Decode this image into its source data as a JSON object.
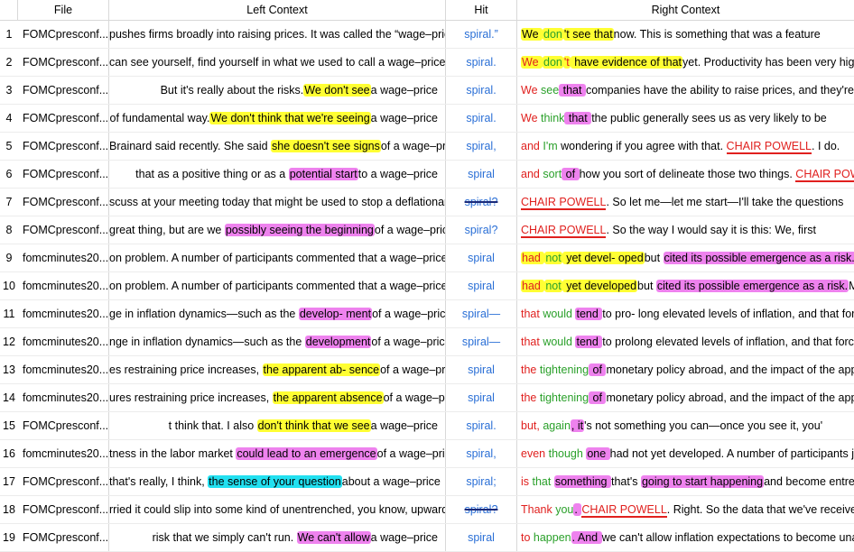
{
  "headers": {
    "file": "File",
    "left": "Left Context",
    "hit": "Hit",
    "right": "Right Context"
  },
  "rows": [
    {
      "n": "1",
      "file": "FOMCpresconf...",
      "left": [
        [
          "",
          "pushes firms broadly into raising prices. It was called the “wage–price"
        ]
      ],
      "hit": "spiral.”",
      "hit_strike": false,
      "right": [
        [
          "y",
          "We "
        ],
        [
          "yg",
          "don"
        ],
        [
          "y",
          "'t see that"
        ],
        [
          "",
          "now. This is something that was a feature"
        ]
      ]
    },
    {
      "n": "2",
      "file": "FOMCpresconf...",
      "left": [
        [
          "",
          "can see yourself, find yourself in what we used to call a wage–price"
        ]
      ],
      "hit": "spiral.",
      "hit_strike": false,
      "right": [
        [
          "yr",
          "We "
        ],
        [
          "yg",
          "don"
        ],
        [
          "yr",
          "'t"
        ],
        [
          "y",
          " have evidence of that"
        ],
        [
          "",
          "yet. Productivity has been very high."
        ]
      ]
    },
    {
      "n": "3",
      "file": "FOMCpresconf...",
      "left": [
        [
          "",
          "But it's really about the risks."
        ],
        [
          "y",
          "We don't see"
        ],
        [
          "",
          "a wage–price"
        ]
      ],
      "hit": "spiral.",
      "hit_strike": false,
      "right": [
        [
          "r",
          "We "
        ],
        [
          "g",
          "see"
        ],
        [
          "m",
          " that "
        ],
        [
          "",
          "companies have the ability to raise prices, and they're"
        ]
      ]
    },
    {
      "n": "4",
      "file": "FOMCpresconf...",
      "left": [
        [
          "",
          "of fundamental way."
        ],
        [
          "y",
          "We don't think that we're seeing"
        ],
        [
          "",
          "a wage–price"
        ]
      ],
      "hit": "spiral.",
      "hit_strike": false,
      "right": [
        [
          "r",
          "We "
        ],
        [
          "g",
          "think"
        ],
        [
          "m",
          " that "
        ],
        [
          "",
          "the public generally sees us as very likely to be"
        ]
      ]
    },
    {
      "n": "5",
      "file": "FOMCpresconf...",
      "left": [
        [
          "",
          "Brainard said recently. She said "
        ],
        [
          "y",
          "she doesn't see signs"
        ],
        [
          "",
          "of a wage–price"
        ]
      ],
      "hit": "spiral,",
      "hit_strike": false,
      "right": [
        [
          "r",
          "and "
        ],
        [
          "g",
          "I'm"
        ],
        [
          "",
          "  wondering if you agree with that. "
        ],
        [
          "u",
          "CHAIR POWELL"
        ],
        [
          "",
          ". I do."
        ]
      ]
    },
    {
      "n": "6",
      "file": "FOMCpresconf...",
      "left": [
        [
          "",
          "that as a positive thing or as a "
        ],
        [
          "m",
          "potential start"
        ],
        [
          "",
          "to a wage–price"
        ]
      ],
      "hit": "spiral",
      "hit_strike": false,
      "right": [
        [
          "r",
          "and "
        ],
        [
          "g",
          "sort"
        ],
        [
          "m",
          " of "
        ],
        [
          "",
          "how you sort of delineate those two things. "
        ],
        [
          "u",
          "CHAIR POWEL"
        ]
      ]
    },
    {
      "n": "7",
      "file": "FOMCpresconf...",
      "left": [
        [
          "",
          "scuss at your meeting today that might be used to stop a deflationary"
        ]
      ],
      "hit": "spiral?",
      "hit_strike": true,
      "right": [
        [
          "u",
          "CHAIR POWELL"
        ],
        [
          "",
          ". So let me—let me start—I'll take the questions"
        ]
      ]
    },
    {
      "n": "8",
      "file": "FOMCpresconf...",
      "left": [
        [
          "",
          "great thing, but are we "
        ],
        [
          "m",
          "possibly seeing the beginning"
        ],
        [
          "",
          "of a wage–price"
        ]
      ],
      "hit": "spiral?",
      "hit_strike": false,
      "right": [
        [
          "u",
          "CHAIR POWELL"
        ],
        [
          "",
          ". So the way I would say it is this: We, first"
        ]
      ]
    },
    {
      "n": "9",
      "file": "fomcminutes20...",
      "left": [
        [
          "",
          "on problem. A number of participants commented that a wage–price"
        ]
      ],
      "hit": "spiral",
      "hit_strike": false,
      "right": [
        [
          "yr",
          "had "
        ],
        [
          "yg",
          "not"
        ],
        [
          "y",
          " yet devel- oped"
        ],
        [
          "",
          "but "
        ],
        [
          "m",
          "cited its possible emergence as a risk."
        ]
      ]
    },
    {
      "n": "10",
      "file": "fomcminutes20...",
      "left": [
        [
          "",
          "on problem. A number of participants commented that a wage–price"
        ]
      ],
      "hit": "spiral",
      "hit_strike": false,
      "right": [
        [
          "yr",
          "had "
        ],
        [
          "yg",
          "not"
        ],
        [
          "y",
          " yet developed"
        ],
        [
          "",
          "but "
        ],
        [
          "m",
          "cited its possible emergence as a risk."
        ],
        [
          "",
          "Minu"
        ]
      ]
    },
    {
      "n": "11",
      "file": "fomcminutes20...",
      "left": [
        [
          "",
          "ge in inflation dynamics—such as the "
        ],
        [
          "m",
          "develop- ment"
        ],
        [
          "",
          "of a wage–price"
        ]
      ],
      "hit": "spiral—",
      "hit_strike": false,
      "right": [
        [
          "r",
          "that "
        ],
        [
          "g",
          "would "
        ],
        [
          "m",
          "tend "
        ],
        [
          "",
          "to pro- long elevated levels of inflation, and that forc"
        ]
      ]
    },
    {
      "n": "12",
      "file": "fomcminutes20...",
      "left": [
        [
          "",
          "nge in inflation dynamics—such as the "
        ],
        [
          "m",
          "development"
        ],
        [
          "",
          "of a wage–price"
        ]
      ],
      "hit": "spiral—",
      "hit_strike": false,
      "right": [
        [
          "r",
          "that "
        ],
        [
          "g",
          "would "
        ],
        [
          "m",
          "tend "
        ],
        [
          "",
          "to prolong elevated levels of inflation, and that forces"
        ]
      ]
    },
    {
      "n": "13",
      "file": "fomcminutes20...",
      "left": [
        [
          "",
          "es restraining price increases, "
        ],
        [
          "y",
          "the apparent ab- sence"
        ],
        [
          "",
          "of a wage–price"
        ]
      ],
      "hit": "spiral",
      "hit_strike": false,
      "right": [
        [
          "r",
          "the "
        ],
        [
          "g",
          "tightening"
        ],
        [
          "m",
          " of "
        ],
        [
          "",
          "monetary policy abroad, and the impact of the appr"
        ]
      ]
    },
    {
      "n": "14",
      "file": "fomcminutes20...",
      "left": [
        [
          "",
          "ures restraining price increases, "
        ],
        [
          "y",
          "the apparent absence"
        ],
        [
          "",
          "of a wage–price"
        ]
      ],
      "hit": "spiral",
      "hit_strike": false,
      "right": [
        [
          "r",
          "the "
        ],
        [
          "g",
          "tightening"
        ],
        [
          "m",
          " of "
        ],
        [
          "",
          "monetary policy abroad, and the impact of the appr"
        ]
      ]
    },
    {
      "n": "15",
      "file": "FOMCpresconf...",
      "left": [
        [
          "",
          "t think that. I also "
        ],
        [
          "y",
          "don't think that we see"
        ],
        [
          "",
          "a wage–price"
        ]
      ],
      "hit": "spiral.",
      "hit_strike": false,
      "right": [
        [
          "r",
          "but, "
        ],
        [
          "g",
          "again"
        ],
        [
          "m",
          ", it"
        ],
        [
          "",
          "'s not something you can—once you see it, you'"
        ]
      ]
    },
    {
      "n": "16",
      "file": "fomcminutes20...",
      "left": [
        [
          "",
          "tness in the labor market "
        ],
        [
          "m",
          "could lead to an emergence"
        ],
        [
          "",
          "of a wage–price"
        ]
      ],
      "hit": "spiral,",
      "hit_strike": false,
      "right": [
        [
          "r",
          "even "
        ],
        [
          "g",
          "though "
        ],
        [
          "m",
          "one "
        ],
        [
          "",
          "had not yet developed. A number of participants jud"
        ]
      ]
    },
    {
      "n": "17",
      "file": "FOMCpresconf...",
      "left": [
        [
          "",
          "that's really, I think, "
        ],
        [
          "c",
          "the sense of your question"
        ],
        [
          "",
          "about a wage–price"
        ]
      ],
      "hit": "spiral;",
      "hit_strike": false,
      "right": [
        [
          "r",
          "is "
        ],
        [
          "g",
          "that "
        ],
        [
          "m",
          "something "
        ],
        [
          "",
          "that's "
        ],
        [
          "m",
          "going to start happening"
        ],
        [
          "",
          "and become entrenc"
        ]
      ]
    },
    {
      "n": "18",
      "file": "FOMCpresconf...",
      "left": [
        [
          "",
          "rried it could slip into some kind of unentrenched, you know, upward"
        ]
      ],
      "hit": "spiral?",
      "hit_strike": true,
      "right": [
        [
          "r",
          "Thank "
        ],
        [
          "g",
          "you"
        ],
        [
          "m",
          ". "
        ],
        [
          "u",
          "CHAIR POWELL"
        ],
        [
          "",
          ". Right. So the data that we've received so"
        ]
      ]
    },
    {
      "n": "19",
      "file": "FOMCpresconf...",
      "left": [
        [
          "",
          "risk that we simply can't run. "
        ],
        [
          "m",
          "We can't allow"
        ],
        [
          "",
          "a wage–price"
        ]
      ],
      "hit": "spiral",
      "hit_strike": false,
      "right": [
        [
          "r",
          "to "
        ],
        [
          "g",
          "happen"
        ],
        [
          "m",
          ". And "
        ],
        [
          "",
          "we can't allow inflation expectations to become unan"
        ]
      ]
    }
  ]
}
